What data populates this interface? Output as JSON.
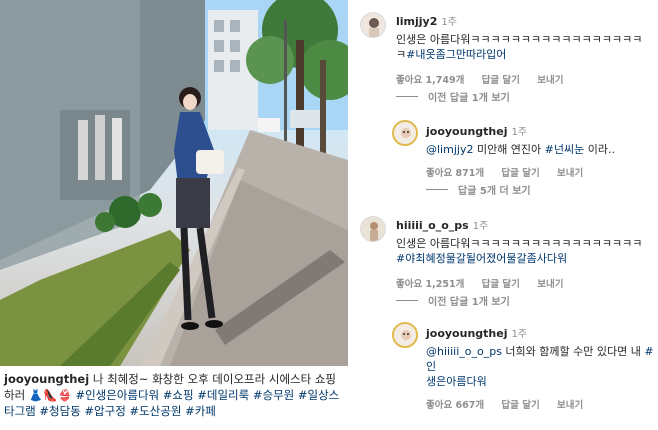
{
  "post": {
    "caption_user": "jooyoungthej",
    "caption_text": " 나 최혜정~ 화창한 오후 데이오프라 시에스타 쇼핑하러 👗👠👙",
    "hashtags": "#인생은아름다워 #쇼핑 #데일리룩 #승무원 #일상스타그램 #청담동 #압구정 #도산공원 #카페"
  },
  "comments": [
    {
      "user": "limjjy2",
      "time": "1주",
      "text_line1": "인생은 아름다워ㅋㅋㅋㅋㅋㅋㅋㅋㅋㅋㅋㅋㅋㅋㅋㅋㅋ",
      "text_line2_plain": "ㅋ",
      "text_line2_tag": "#내옷좀그만따라입어",
      "likes": "좋아요 1,749개",
      "reply": "답글 달기",
      "send": "보내기",
      "view_replies": "이전 답글 1개 보기"
    },
    {
      "user": "jooyoungthej",
      "time": "1주",
      "mention": "@limjjy2",
      "text_mid": " 미안해 연진아 ",
      "tag": "#넌씨눈",
      "text_end": " 이라..",
      "likes": "좋아요 871개",
      "reply": "답글 달기",
      "send": "보내기",
      "view_replies": "답글 5개 더 보기"
    },
    {
      "user": "hiiiii_o_o_ps",
      "time": "1주",
      "text_line1": "인생은 아름다워ㅋㅋㅋㅋㅋㅋㅋㅋㅋㅋㅋㅋㅋㅋㅋㅋㅋ",
      "tag": "#야최혜정물갈될어졌어물갈좀사다워",
      "likes": "좋아요 1,251개",
      "reply": "답글 달기",
      "send": "보내기",
      "view_replies": "이전 답글 1개 보기"
    },
    {
      "user": "jooyoungthej",
      "time": "1주",
      "mention": "@hiiiii_o_o_ps",
      "text_mid": " 너희와 함께할 수만 있다면 내 ",
      "tag_line1": "#인",
      "tag_line2": "생은아름다워",
      "likes": "좋아요 667개",
      "reply": "답글 달기",
      "send": "보내기"
    }
  ]
}
